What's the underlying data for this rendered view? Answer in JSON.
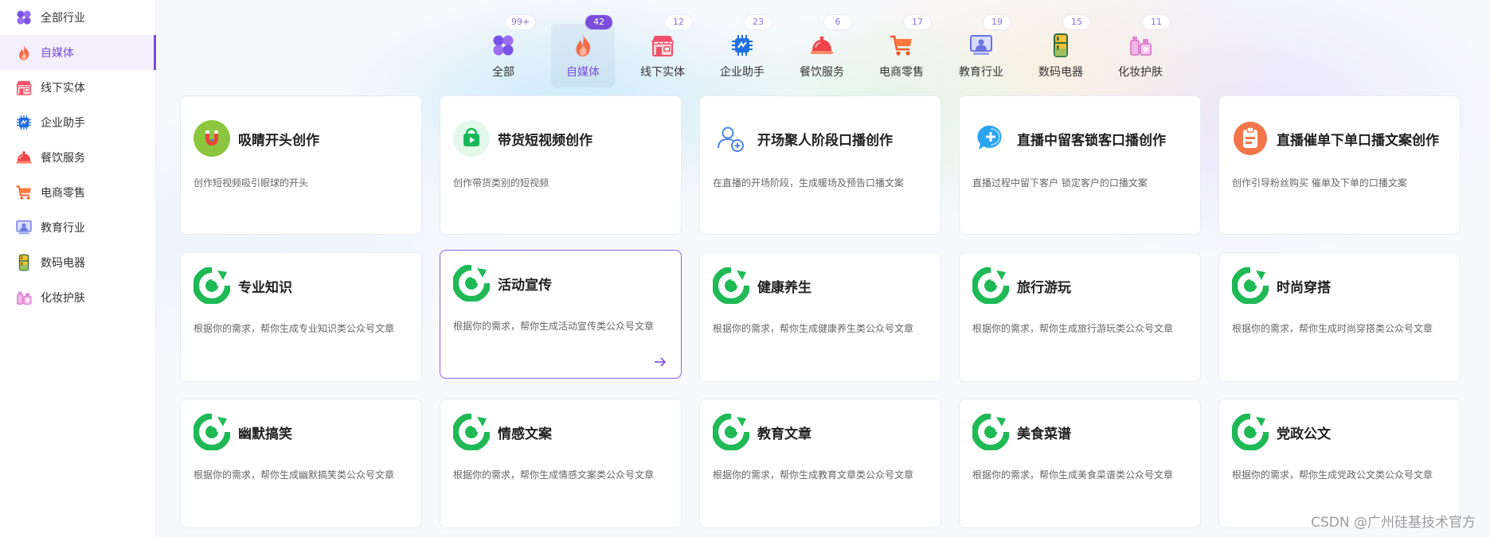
{
  "sidebar": {
    "items": [
      {
        "label": "全部行业",
        "icon": "grid-clover-icon",
        "active": false
      },
      {
        "label": "自媒体",
        "icon": "fire-icon",
        "active": true
      },
      {
        "label": "线下实体",
        "icon": "storefront-icon",
        "active": false
      },
      {
        "label": "企业助手",
        "icon": "chip-icon",
        "active": false
      },
      {
        "label": "餐饮服务",
        "icon": "cloche-icon",
        "active": false
      },
      {
        "label": "电商零售",
        "icon": "shopping-cart-icon",
        "active": false
      },
      {
        "label": "教育行业",
        "icon": "teacher-board-icon",
        "active": false
      },
      {
        "label": "数码电器",
        "icon": "appliance-icon",
        "active": false
      },
      {
        "label": "化妆护肤",
        "icon": "cosmetics-icon",
        "active": false
      }
    ]
  },
  "tabs": [
    {
      "label": "全部",
      "badge": "99+",
      "icon": "grid-clover-icon",
      "active": false
    },
    {
      "label": "自媒体",
      "badge": "42",
      "icon": "fire-icon",
      "active": true
    },
    {
      "label": "线下实体",
      "badge": "12",
      "icon": "storefront-icon",
      "active": false
    },
    {
      "label": "企业助手",
      "badge": "23",
      "icon": "chip-icon",
      "active": false
    },
    {
      "label": "餐饮服务",
      "badge": "6",
      "icon": "cloche-icon",
      "active": false
    },
    {
      "label": "电商零售",
      "badge": "17",
      "icon": "shopping-cart-icon",
      "active": false
    },
    {
      "label": "教育行业",
      "badge": "19",
      "icon": "teacher-board-icon",
      "active": false
    },
    {
      "label": "数码电器",
      "badge": "15",
      "icon": "appliance-icon",
      "active": false
    },
    {
      "label": "化妆护肤",
      "badge": "11",
      "icon": "cosmetics-icon",
      "active": false
    }
  ],
  "cards": [
    {
      "title": "吸睛开头创作",
      "desc": "创作短视频吸引眼球的开头",
      "icon": "magnet-icon"
    },
    {
      "title": "带货短视频创作",
      "desc": "创作带货类别的短视频",
      "icon": "shopping-bag-icon"
    },
    {
      "title": "开场聚人阶段口播创作",
      "desc": "在直播的开场阶段，生成暖场及预告口播文案",
      "icon": "user-add-icon"
    },
    {
      "title": "直播中留客锁客口播创作",
      "desc": "直播过程中留下客户 锁定客户的口播文案",
      "icon": "chat-plus-icon"
    },
    {
      "title": "直播催单下单口播文案创作",
      "desc": "创作引导粉丝购买 催单及下单的口播文案",
      "icon": "clipboard-icon"
    },
    {
      "title": "专业知识",
      "desc": "根据你的需求，帮你生成专业知识类公众号文章",
      "icon": "wechat-official-icon"
    },
    {
      "title": "活动宣传",
      "desc": "根据你的需求，帮你生成活动宣传类公众号文章",
      "icon": "wechat-official-icon",
      "highlight": true
    },
    {
      "title": "健康养生",
      "desc": "根据你的需求，帮你生成健康养生类公众号文章",
      "icon": "wechat-official-icon"
    },
    {
      "title": "旅行游玩",
      "desc": "根据你的需求，帮你生成旅行游玩类公众号文章",
      "icon": "wechat-official-icon"
    },
    {
      "title": "时尚穿搭",
      "desc": "根据你的需求，帮你生成时尚穿搭类公众号文章",
      "icon": "wechat-official-icon"
    },
    {
      "title": "幽默搞笑",
      "desc": "根据你的需求，帮你生成幽默搞笑类公众号文章",
      "icon": "wechat-official-icon"
    },
    {
      "title": "情感文案",
      "desc": "根据你的需求，帮你生成情感文案类公众号文章",
      "icon": "wechat-official-icon"
    },
    {
      "title": "教育文章",
      "desc": "根据你的需求，帮你生成教育文章类公众号文章",
      "icon": "wechat-official-icon"
    },
    {
      "title": "美食菜谱",
      "desc": "根据你的需求，帮你生成美食菜谱类公众号文章",
      "icon": "wechat-official-icon"
    },
    {
      "title": "党政公文",
      "desc": "根据你的需求，帮你生成党政公文类公众号文章",
      "icon": "wechat-official-icon"
    }
  ],
  "watermark": "CSDN @广州硅基技术官方",
  "colors": {
    "accent": "#7b4ddb",
    "sidebar_active_bg": "#f3effd",
    "wechat_green": "#1fb955",
    "card_border": "#e8ebf2"
  }
}
